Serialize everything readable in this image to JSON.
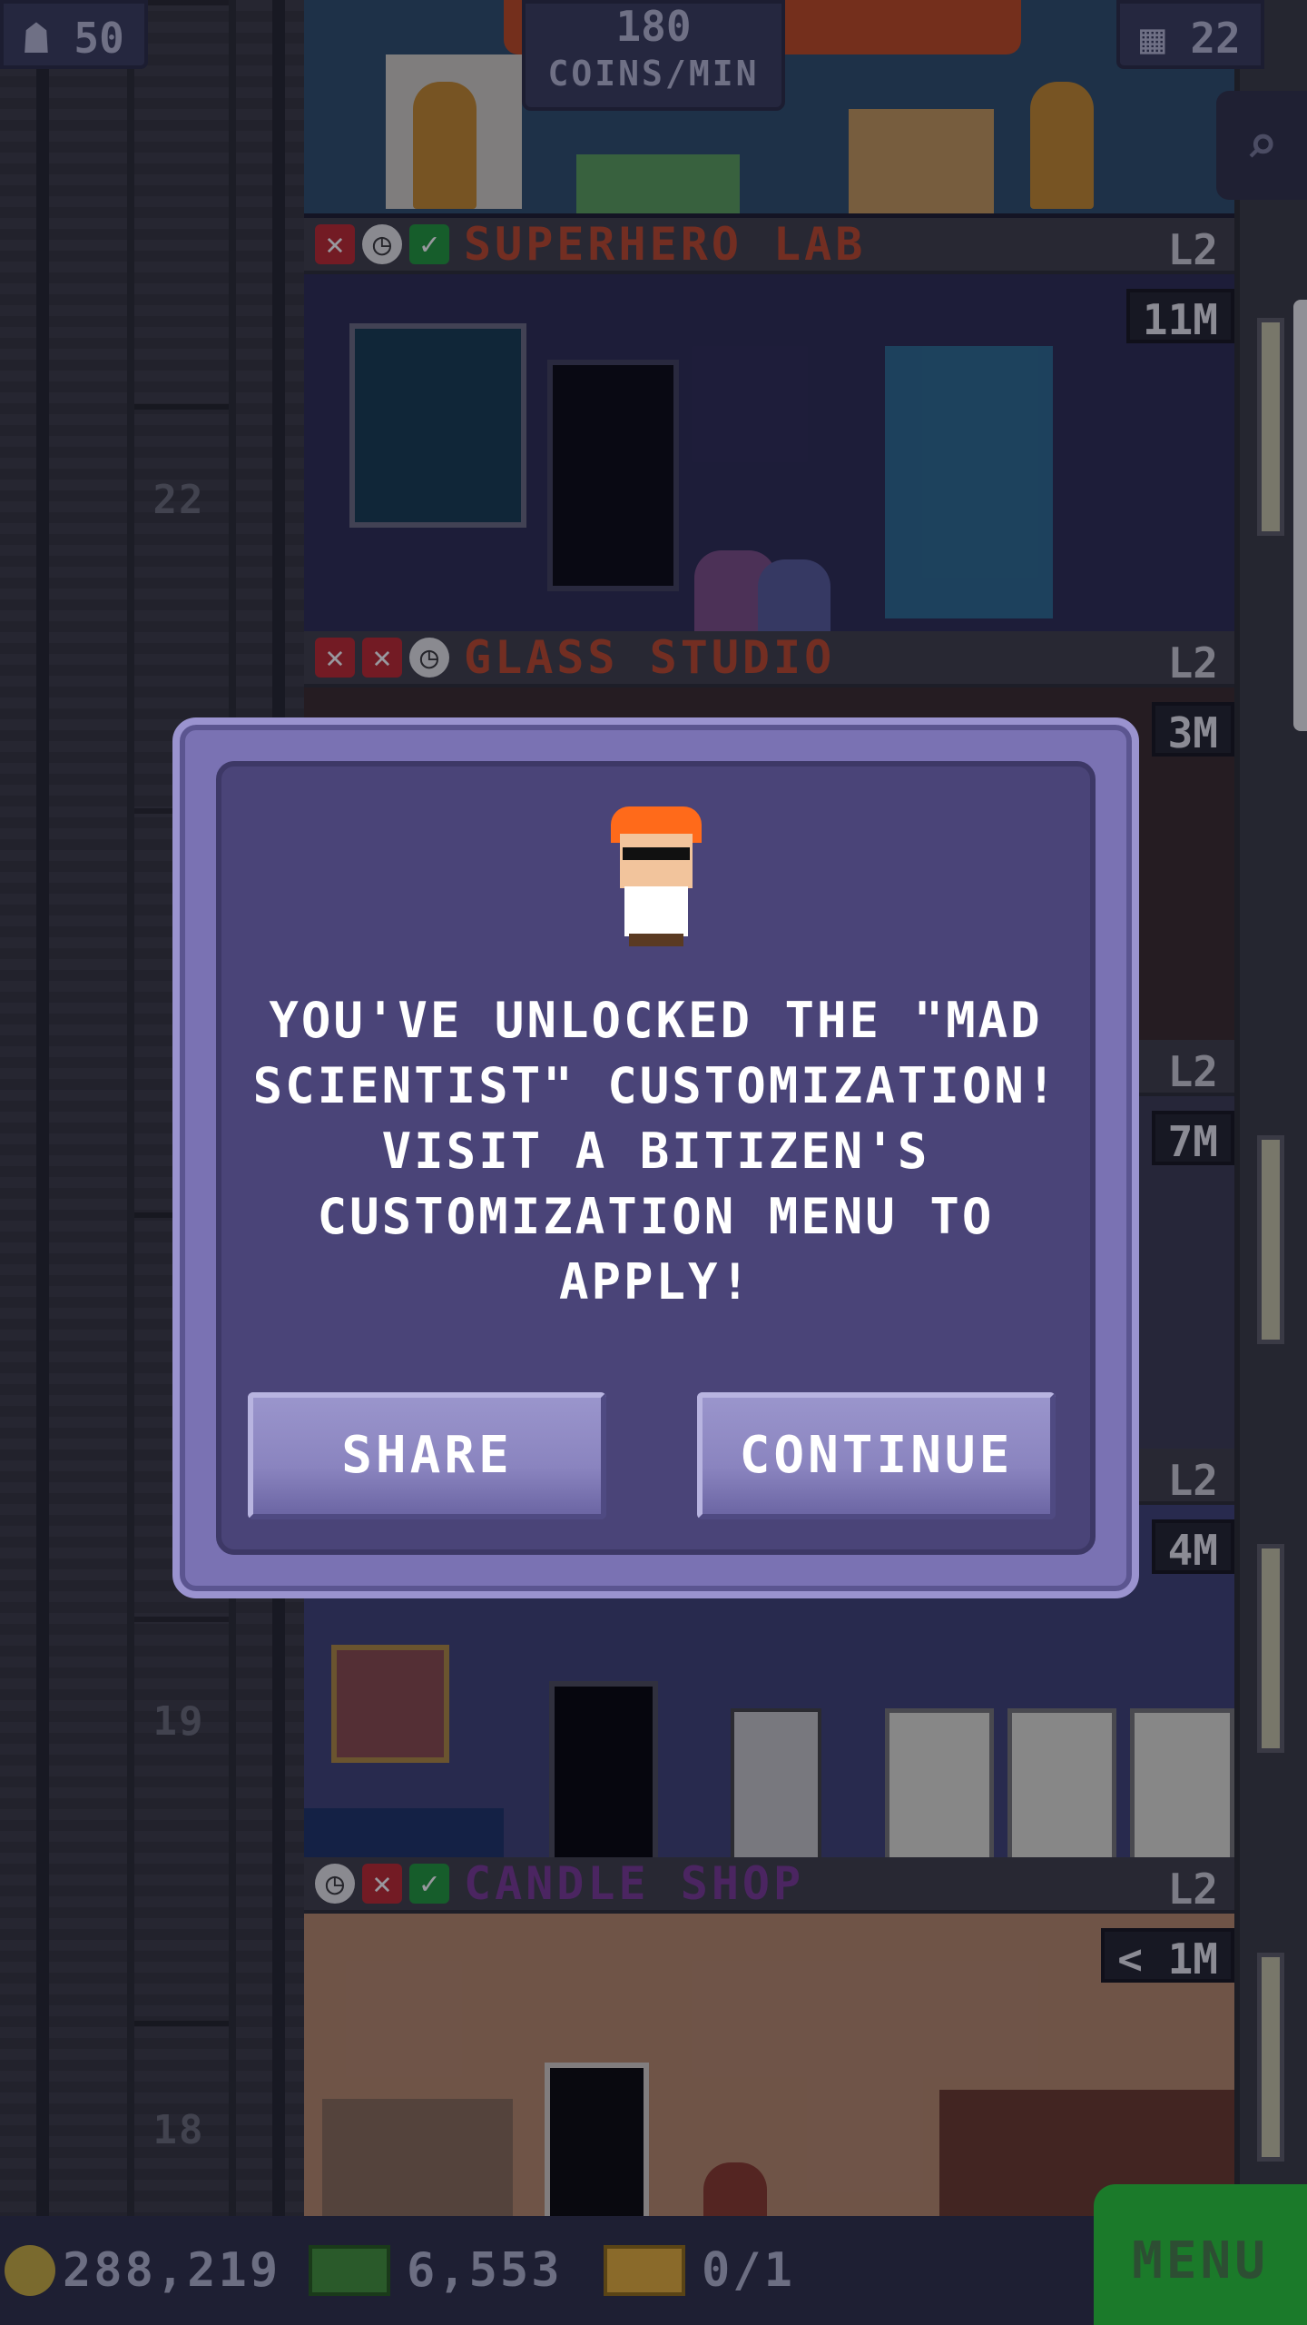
{
  "hud": {
    "population": "50",
    "coins_per_min_value": "180",
    "coins_per_min_label": "COINS/MIN",
    "floors": "22"
  },
  "floors": [
    {
      "name": "SUPERHERO LAB",
      "level": "L2",
      "price": "11M",
      "color": "#c0492a"
    },
    {
      "name": "GLASS STUDIO",
      "level": "L2",
      "price": "3M",
      "color": "#c0492a"
    },
    {
      "name": "",
      "level": "L2",
      "price": "7M",
      "color": "#c0492a"
    },
    {
      "name": "",
      "level": "L2",
      "price": "4M",
      "color": "#c0492a"
    },
    {
      "name": "CANDLE SHOP",
      "level": "L2",
      "price": "< 1M",
      "color": "#7b3a96"
    }
  ],
  "floor_numbers": [
    "22",
    "19",
    "18"
  ],
  "modal": {
    "message": "YOU'VE UNLOCKED THE \"MAD SCIENTIST\" CUSTOMIZATION! VISIT A BITIZEN'S CUSTOMIZATION MENU TO APPLY!",
    "share_label": "SHARE",
    "continue_label": "CONTINUE"
  },
  "bottom_bar": {
    "coins": "288,219",
    "bux": "6,553",
    "tickets": "0/1",
    "menu_label": "MENU"
  },
  "colors": {
    "modal_bg": "#4a4478",
    "modal_frame": "#7a72b3",
    "button": "#8a84bf",
    "menu_green": "#1b7a2a"
  }
}
